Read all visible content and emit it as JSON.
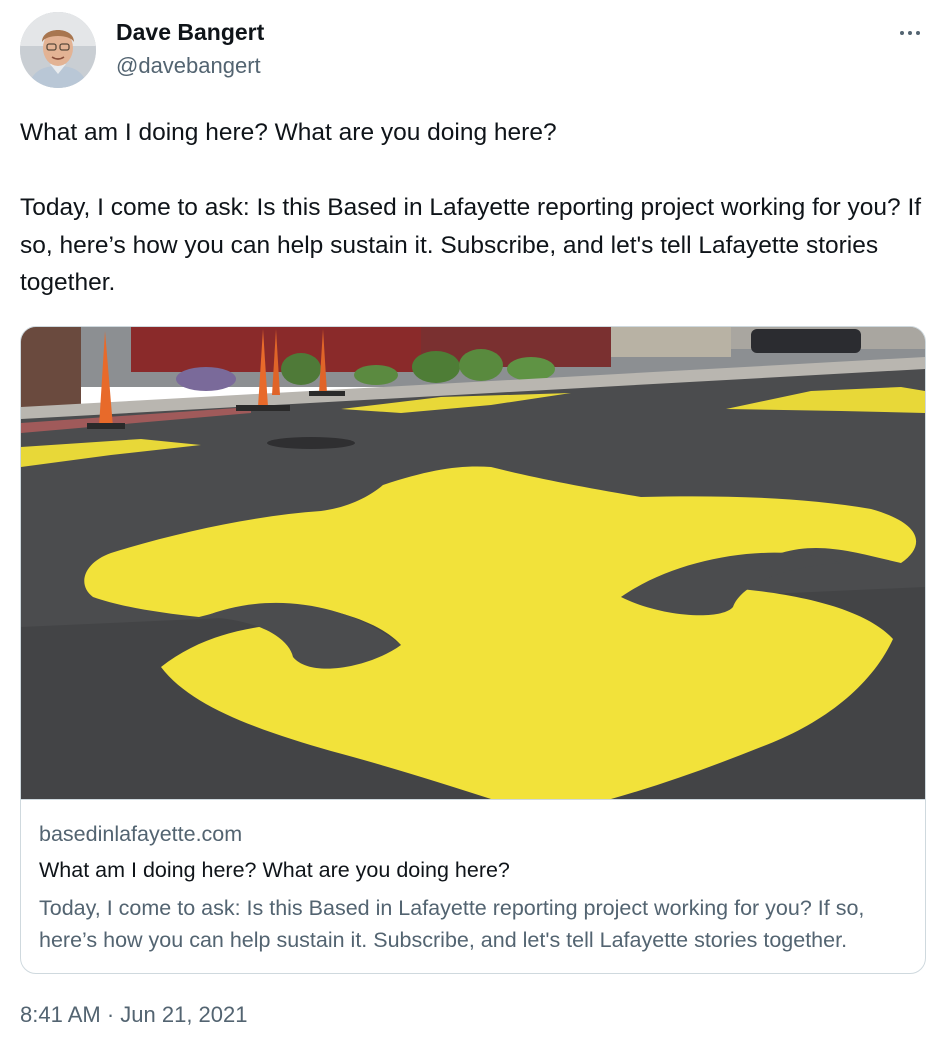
{
  "author": {
    "name": "Dave Bangert",
    "handle": "@davebangert",
    "avatar": "avatar-photo"
  },
  "header": {
    "more_icon": "ellipsis-icon"
  },
  "tweet": {
    "paragraphs": [
      "What am I doing here? What are you doing here?",
      "Today, I come to ask: Is this Based in Lafayette reporting project working for you? If so, here’s how you can help sustain it. Subscribe, and let's tell Lafayette stories together."
    ],
    "timestamp": "8:41 AM · Jun 21, 2021"
  },
  "link_card": {
    "image": "yellow fleur-de-lis painted on street",
    "domain": "basedinlafayette.com",
    "title": "What am I doing here? What are you doing here?",
    "description": "Today, I come to ask: Is this Based in Lafayette reporting project working for you? If so, here’s how you can help sustain it. Subscribe, and let's tell Lafayette stories together."
  },
  "colors": {
    "text_primary": "#0f1419",
    "text_secondary": "#536471",
    "border": "#cfd9de",
    "fleur_yellow": "#f2e23a",
    "asphalt": "#4b4c4e"
  }
}
